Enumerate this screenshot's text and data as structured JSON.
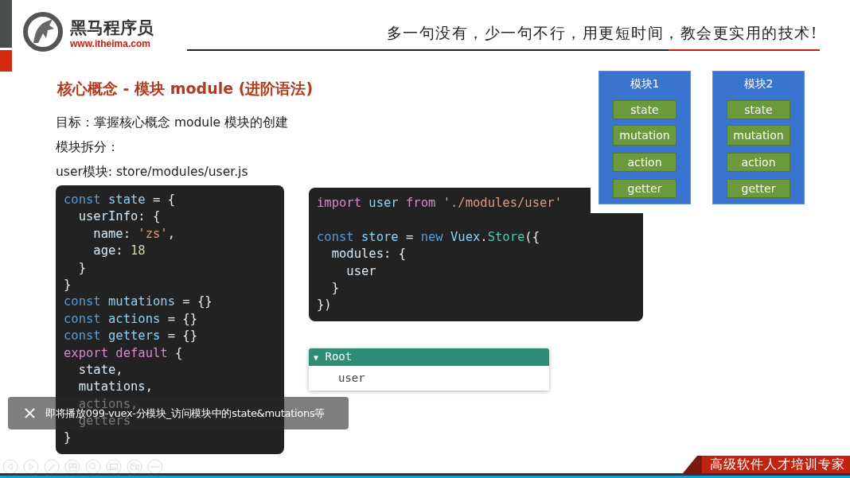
{
  "header": {
    "brand": "黑马程序员",
    "url": "www.itheima.com",
    "slogan": "多一句没有，少一句不行，用更短时间，教会更实用的技术!"
  },
  "slide": {
    "title": "核心概念 - 模块 module (进阶语法)",
    "lines": [
      "目标：掌握核心概念 module 模块的创建",
      "模块拆分：",
      "user模块: store/modules/user.js"
    ],
    "code_blocks": [
      {
        "paragraphs": [
          [
            [
              {
                "t": "const",
                "color": "#569cd6"
              },
              {
                "t": " state",
                "color": "#8fd0f5"
              },
              {
                "t": " = {"
              }
            ],
            [
              {
                "t": "  userInfo",
                "color": "#d6e8f5"
              },
              {
                "t": ": {"
              }
            ],
            [
              {
                "t": "    name",
                "color": "#d6e8f5"
              },
              {
                "t": ": "
              },
              {
                "t": "'zs'",
                "color": "#d69d85"
              },
              {
                "t": ","
              }
            ],
            [
              {
                "t": "    age",
                "color": "#d6e8f5"
              },
              {
                "t": ": "
              },
              {
                "t": "18",
                "color": "#c9d9a8"
              }
            ],
            [
              {
                "t": "  }"
              }
            ],
            [
              {
                "t": "}"
              }
            ],
            [
              {
                "t": "const",
                "color": "#569cd6"
              },
              {
                "t": " mutations",
                "color": "#8fd0f5"
              },
              {
                "t": " = {}"
              }
            ],
            [
              {
                "t": "const",
                "color": "#569cd6"
              },
              {
                "t": " actions",
                "color": "#8fd0f5"
              },
              {
                "t": " = {}"
              }
            ],
            [
              {
                "t": "const",
                "color": "#569cd6"
              },
              {
                "t": " getters",
                "color": "#8fd0f5"
              },
              {
                "t": " = {}"
              }
            ],
            [
              {
                "t": "export",
                "color": "#d08bc8"
              },
              {
                "t": " default",
                "color": "#d08bc8"
              },
              {
                "t": " {"
              }
            ],
            [
              {
                "t": "  state",
                "color": "#d6e8f5"
              },
              {
                "t": ","
              }
            ],
            [
              {
                "t": "  mutations",
                "color": "#d6e8f5"
              },
              {
                "t": ","
              }
            ],
            [
              {
                "t": "  actions,"
              }
            ],
            [
              {
                "t": "  getters"
              }
            ],
            [
              {
                "t": "}"
              }
            ]
          ]
        ]
      },
      {
        "paragraphs": [
          [
            [
              {
                "t": "import",
                "color": "#d08bc8"
              },
              {
                "t": " user",
                "color": "#8fd0f5"
              },
              {
                "t": " from",
                "color": "#d08bc8"
              },
              {
                "t": " './modules/user'",
                "color": "#d69d85"
              }
            ]
          ],
          [
            [
              {
                "t": "const",
                "color": "#569cd6"
              },
              {
                "t": " store",
                "color": "#8fd0f5"
              },
              {
                "t": " ="
              },
              {
                "t": " new",
                "color": "#569cd6"
              },
              {
                "t": " Vuex",
                "color": "#8fd0f5"
              },
              {
                "t": "."
              },
              {
                "t": "Store",
                "color": "#4ec9b0"
              },
              {
                "t": "({"
              }
            ],
            [
              {
                "t": "  modules",
                "color": "#d6e8f5"
              },
              {
                "t": ": {"
              }
            ],
            [
              {
                "t": "    user",
                "color": "#d6e8f5"
              }
            ],
            [
              {
                "t": "  }"
              }
            ],
            [
              {
                "t": "})"
              }
            ]
          ]
        ]
      }
    ],
    "tree": {
      "toggle": "▼",
      "label": "Root",
      "expanded": true,
      "children": [
        {
          "label": "user"
        }
      ]
    },
    "modules": [
      {
        "title": "模块1",
        "items": [
          "state",
          "mutation",
          "action",
          "getter"
        ]
      },
      {
        "title": "模块2",
        "items": [
          "state",
          "mutation",
          "action",
          "getter"
        ]
      }
    ],
    "banner": "高级软件人才培训专家"
  },
  "player": {
    "toast": "即将播放099-vuex-分模块_访问模块中的state&mutations等"
  }
}
